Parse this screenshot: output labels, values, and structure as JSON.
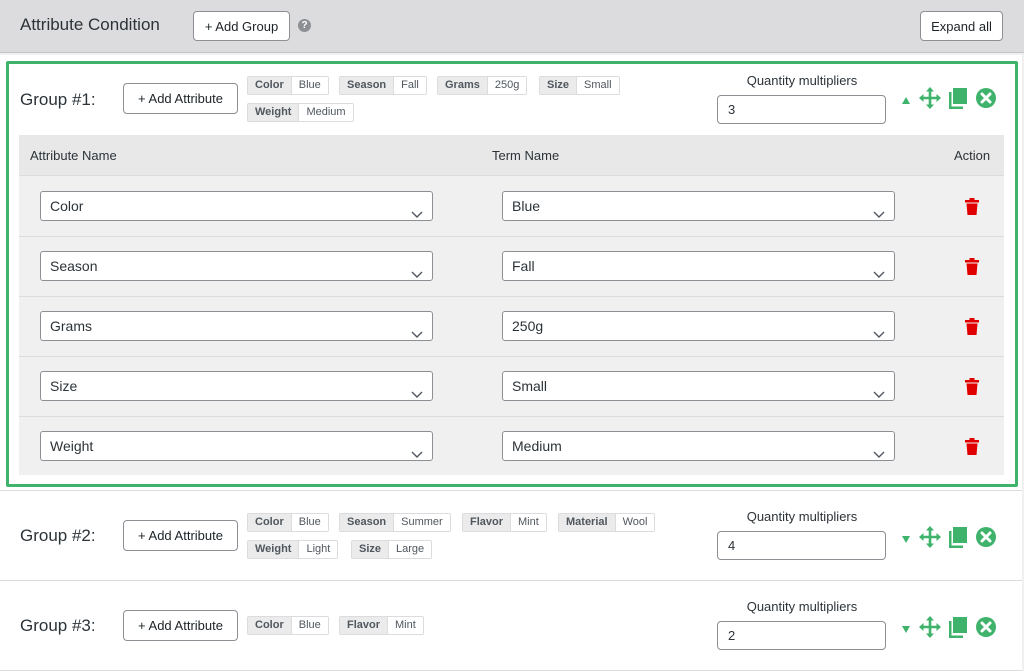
{
  "header": {
    "title": "Attribute Condition",
    "add_group_label": "+ Add Group",
    "help_glyph": "?",
    "expand_all_label": "Expand all"
  },
  "colors": {
    "accent_green": "#3fb36b",
    "delete_red": "#e00000"
  },
  "groups": [
    {
      "label": "Group #1:",
      "add_attribute_label": "+ Add Attribute",
      "expanded": true,
      "tags": [
        {
          "key": "Color",
          "value": "Blue"
        },
        {
          "key": "Season",
          "value": "Fall"
        },
        {
          "key": "Grams",
          "value": "250g"
        },
        {
          "key": "Size",
          "value": "Small"
        },
        {
          "key": "Weight",
          "value": "Medium"
        }
      ],
      "quantity_label": "Quantity multipliers",
      "quantity_value": "3",
      "table": {
        "headers": {
          "attribute": "Attribute Name",
          "term": "Term Name",
          "action": "Action"
        },
        "rows": [
          {
            "attribute": "Color",
            "term": "Blue"
          },
          {
            "attribute": "Season",
            "term": "Fall"
          },
          {
            "attribute": "Grams",
            "term": "250g"
          },
          {
            "attribute": "Size",
            "term": "Small"
          },
          {
            "attribute": "Weight",
            "term": "Medium"
          }
        ]
      }
    },
    {
      "label": "Group #2:",
      "add_attribute_label": "+ Add Attribute",
      "expanded": false,
      "tags": [
        {
          "key": "Color",
          "value": "Blue"
        },
        {
          "key": "Season",
          "value": "Summer"
        },
        {
          "key": "Flavor",
          "value": "Mint"
        },
        {
          "key": "Material",
          "value": "Wool"
        },
        {
          "key": "Weight",
          "value": "Light"
        },
        {
          "key": "Size",
          "value": "Large"
        }
      ],
      "quantity_label": "Quantity multipliers",
      "quantity_value": "4"
    },
    {
      "label": "Group #3:",
      "add_attribute_label": "+ Add Attribute",
      "expanded": false,
      "tags": [
        {
          "key": "Color",
          "value": "Blue"
        },
        {
          "key": "Flavor",
          "value": "Mint"
        }
      ],
      "quantity_label": "Quantity multipliers",
      "quantity_value": "2"
    }
  ],
  "icons": {
    "collapse": "triangle-up-icon",
    "expand": "triangle-down-icon",
    "move": "move-arrows-icon",
    "duplicate": "copy-icon",
    "remove": "close-circle-icon",
    "delete_row": "trash-icon",
    "dropdown": "chevron-down-icon",
    "help": "help-icon"
  }
}
